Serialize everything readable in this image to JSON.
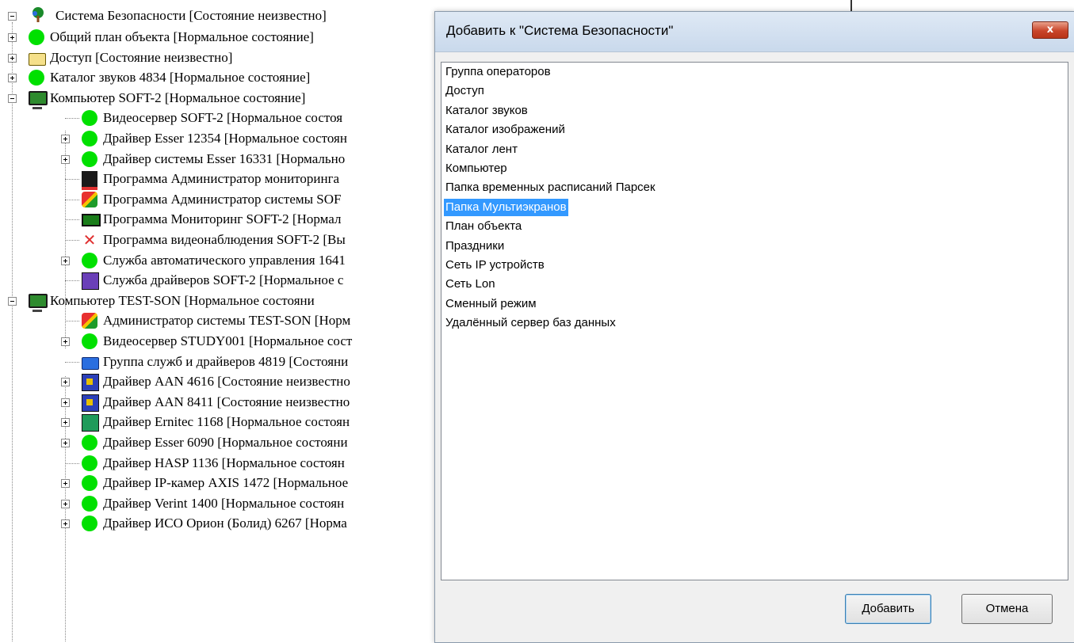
{
  "tree": {
    "root": {
      "label": "Система Безопасности [Состояние неизвестно]",
      "icon": "tree-icon"
    },
    "items": [
      {
        "label": "Общий план объекта [Нормальное состояние]",
        "icon": "green-status-icon"
      },
      {
        "label": "Доступ [Состояние неизвестно]",
        "icon": "folder-icon"
      },
      {
        "label": "Каталог звуков 4834 [Нормальное состояние]",
        "icon": "green-status-icon"
      },
      {
        "label": "Компьютер SOFT-2 [Нормальное состояние]",
        "icon": "computer-icon"
      },
      {
        "label": "Видеосервер SOFT-2 [Нормальное состоя",
        "icon": "green-status-icon"
      },
      {
        "label": "Драйвер Esser 12354 [Нормальное состоян",
        "icon": "green-status-icon"
      },
      {
        "label": "Драйвер системы Esser 16331 [Нормально",
        "icon": "green-status-icon"
      },
      {
        "label": "Программа Администратор мониторинга",
        "icon": "monitoring-admin-icon"
      },
      {
        "label": "Программа Администратор системы SOF",
        "icon": "admin-icon"
      },
      {
        "label": "Программа Мониторинг SOFT-2 [Нормал",
        "icon": "monitor-icon"
      },
      {
        "label": "Программа видеонаблюдения SOFT-2 [Вы",
        "icon": "disabled-x-icon"
      },
      {
        "label": "Служба автоматического управления 1641",
        "icon": "green-status-icon"
      },
      {
        "label": "Служба драйверов SOFT-2 [Нормальное с",
        "icon": "service-icon"
      },
      {
        "label": "Компьютер TEST-SON [Нормальное состояни",
        "icon": "computer-icon"
      },
      {
        "label": "Администратор системы TEST-SON [Норм",
        "icon": "admin-icon"
      },
      {
        "label": "Видеосервер STUDY001 [Нормальное сост",
        "icon": "green-status-icon"
      },
      {
        "label": "Группа служб и драйверов 4819 [Состояни",
        "icon": "blue-folder-icon"
      },
      {
        "label": "Драйвер AAN 4616 [Состояние неизвестно",
        "icon": "chip-icon"
      },
      {
        "label": "Драйвер AAN 8411 [Состояние неизвестно",
        "icon": "chip-icon"
      },
      {
        "label": "Драйвер Ernitec 1168 [Нормальное состоян",
        "icon": "driver-icon"
      },
      {
        "label": "Драйвер Esser 6090 [Нормальное состояни",
        "icon": "green-status-icon"
      },
      {
        "label": "Драйвер HASP 1136 [Нормальное состоян",
        "icon": "green-status-icon"
      },
      {
        "label": "Драйвер IP-камер AXIS 1472 [Нормальное",
        "icon": "green-status-icon"
      },
      {
        "label": "Драйвер Verint 1400 [Нормальное состоян",
        "icon": "green-status-icon"
      },
      {
        "label": "Драйвер ИСО Орион (Болид) 6267 [Норма",
        "icon": "green-status-icon"
      }
    ]
  },
  "dialog": {
    "title": "Добавить к \"Система Безопасности\"",
    "close_label": "x",
    "list": [
      "Группа операторов",
      "Доступ",
      "Каталог звуков",
      "Каталог изображений",
      "Каталог лент",
      "Компьютер",
      "Папка временных расписаний Парсек",
      "Папка Мультиэкранов",
      "План объекта",
      "Праздники",
      "Сеть IP устройств",
      "Сеть Lon",
      "Сменный режим",
      "Удалённый сервер баз данных"
    ],
    "selected_item": "Папка Мультиэкранов",
    "add_label": "Добавить",
    "cancel_label": "Отмена"
  },
  "colors": {
    "selection": "#3399ff",
    "status_ok": "#00e000",
    "close_button": "#c9452a"
  }
}
